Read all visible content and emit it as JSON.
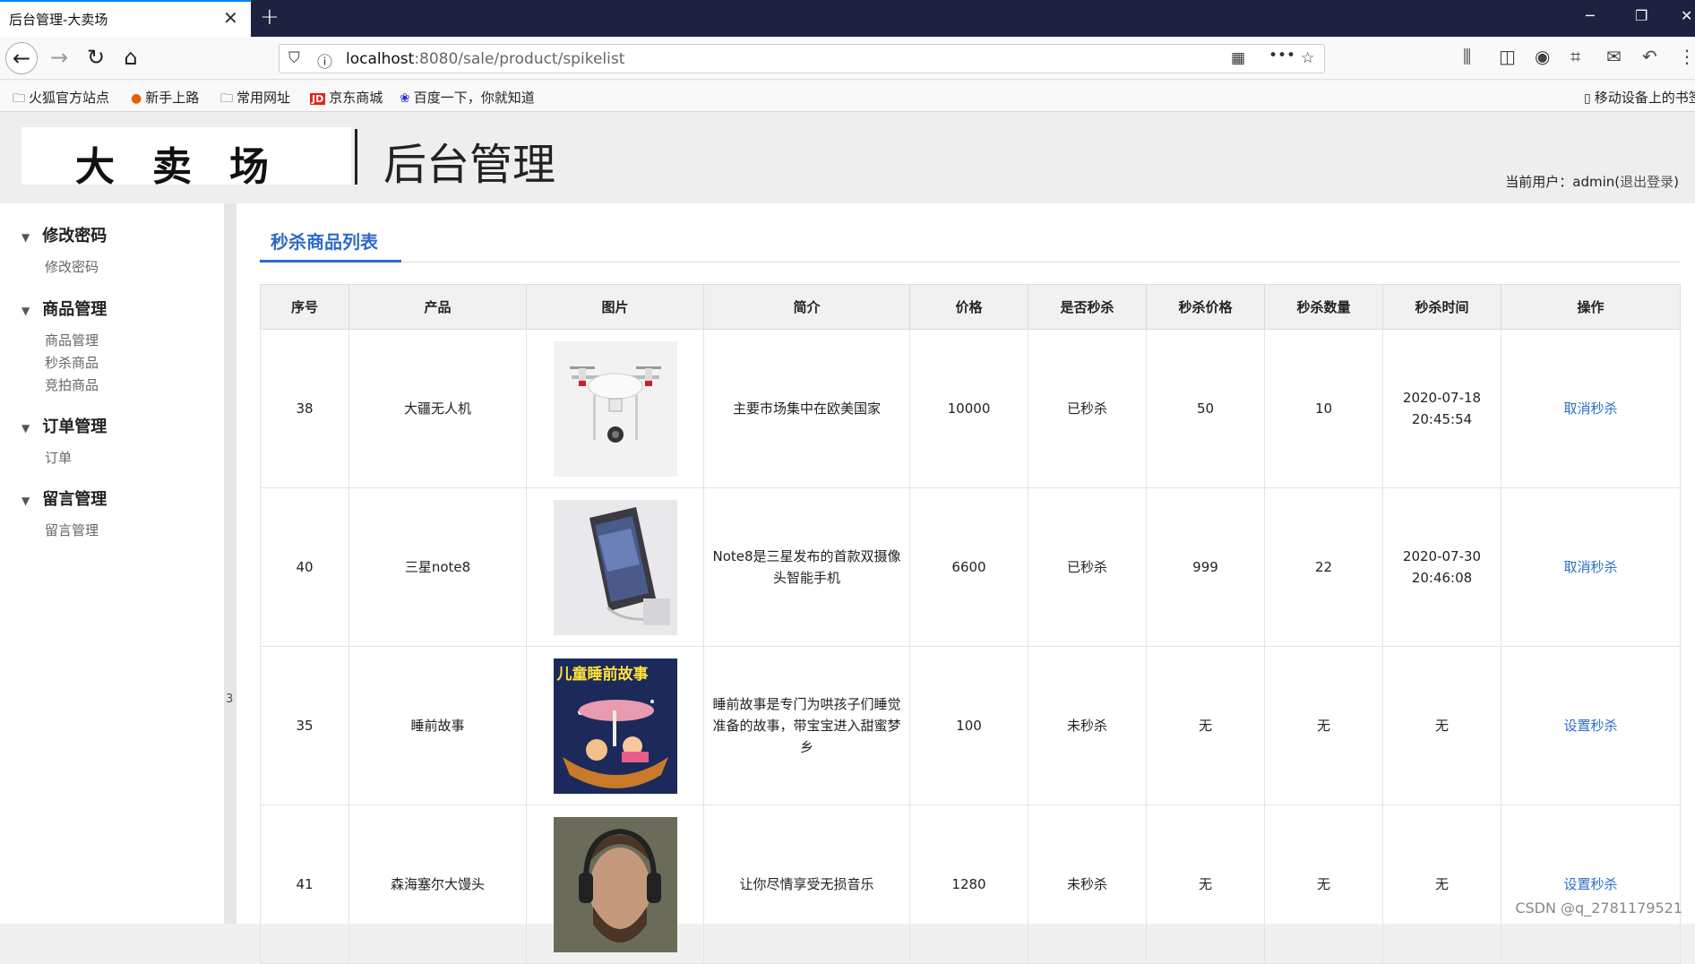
{
  "browser": {
    "tab_title": "后台管理-大卖场",
    "url_host": "localhost",
    "url_rest": ":8080/sale/product/spikelist",
    "bookmarks": [
      "火狐官方站点",
      "新手上路",
      "常用网址",
      "京东商城",
      "百度一下，你就知道"
    ],
    "mobile_bookmarks": "移动设备上的书签"
  },
  "header": {
    "logo": "大卖场",
    "title": "后台管理",
    "current_user_label": "当前用户：admin(",
    "logout": "退出登录",
    "close_paren": ")"
  },
  "sidebar": {
    "groups": [
      {
        "title": "修改密码",
        "items": [
          "修改密码"
        ]
      },
      {
        "title": "商品管理",
        "items": [
          "商品管理",
          "秒杀商品",
          "竞拍商品"
        ]
      },
      {
        "title": "订单管理",
        "items": [
          "订单"
        ]
      },
      {
        "title": "留言管理",
        "items": [
          "留言管理"
        ]
      }
    ],
    "splitter_label": "3"
  },
  "main": {
    "tab": "秒杀商品列表",
    "columns": [
      "序号",
      "产品",
      "图片",
      "简介",
      "价格",
      "是否秒杀",
      "秒杀价格",
      "秒杀数量",
      "秒杀时间",
      "操作"
    ],
    "rows": [
      {
        "id": "38",
        "name": "大疆无人机",
        "image": "drone-image",
        "desc": "主要市场集中在欧美国家",
        "price": "10000",
        "spike": "已秒杀",
        "spike_price": "50",
        "spike_qty": "10",
        "spike_time": "2020-07-18 20:45:54",
        "action": "取消秒杀"
      },
      {
        "id": "40",
        "name": "三星note8",
        "image": "phone-image",
        "desc": "Note8是三星发布的首款双摄像头智能手机",
        "price": "6600",
        "spike": "已秒杀",
        "spike_price": "999",
        "spike_qty": "22",
        "spike_time": "2020-07-30 20:46:08",
        "action": "取消秒杀"
      },
      {
        "id": "35",
        "name": "睡前故事",
        "image": "storybook-image",
        "image_text": "儿童睡前故事",
        "desc": "睡前故事是专门为哄孩子们睡觉准备的故事，带宝宝进入甜蜜梦乡",
        "price": "100",
        "spike": "未秒杀",
        "spike_price": "无",
        "spike_qty": "无",
        "spike_time": "无",
        "action": "设置秒杀"
      },
      {
        "id": "41",
        "name": "森海塞尔大馒头",
        "image": "headphones-man-image",
        "desc": "让你尽情享受无损音乐",
        "price": "1280",
        "spike": "未秒杀",
        "spike_price": "无",
        "spike_qty": "无",
        "spike_time": "无",
        "action": "设置秒杀"
      }
    ]
  },
  "watermark": "CSDN @q_2781179521"
}
